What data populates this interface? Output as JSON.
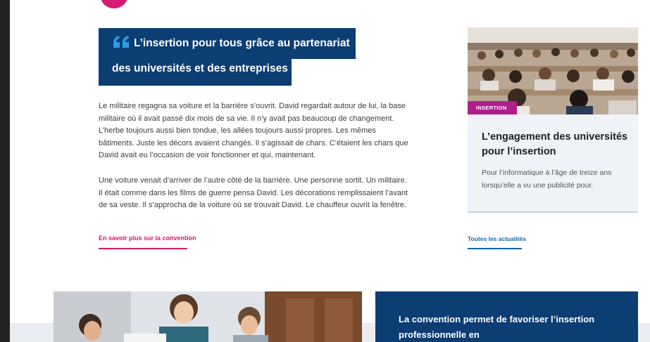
{
  "quote": {
    "line1": "L’insertion pour tous grâce au partenariat",
    "line2": "des universités et des entreprises"
  },
  "article": {
    "p1_lines": [
      "Le militaire regagna sa voiture et la barrière s’ouvrit. David regardait autour de lui, la base",
      "militaire où il avait passé dix mois de sa vie. Il n’y avait pas beaucoup de changement.",
      "L’herbe toujours aussi bien tondue, les allées toujours aussi propres. Les mêmes",
      "bâtiments. Juste les décors avaient changés. Il s’agissait de chars. C’étaient les chars que",
      "David avait eu l’occasion de voir fonctionner et qui, maintenant."
    ],
    "p2_lines": [
      "Une voiture venait d’arriver de l’autre côté de la barrière. Une personne sortit. Un militaire.",
      "Il était comme dans les films de guerre pensa David. Les décorations remplissaient l’avant",
      "de sa veste. Il s’approcha de la voiture où se trouvait David. Le chauffeur ouvrit la fenêtre."
    ],
    "link": "En savoir plus sur la convention"
  },
  "card": {
    "tag": "INSERTION",
    "title": "L’engagement des universités pour l’insertion",
    "desc": "Pour l’informatique à l’âge de treize ans lorsqu’elle a vu une publicité pour."
  },
  "news_link": "Toutes les actualités",
  "bottom_card": {
    "title": "La convention permet de favoriser l’insertion professionnelle en"
  },
  "colors": {
    "navy": "#0c3d73",
    "pink": "#d6186b",
    "magenta_tag": "#b01e8e",
    "link_blue": "#1466a8"
  },
  "icons": [
    "quote-icon"
  ]
}
